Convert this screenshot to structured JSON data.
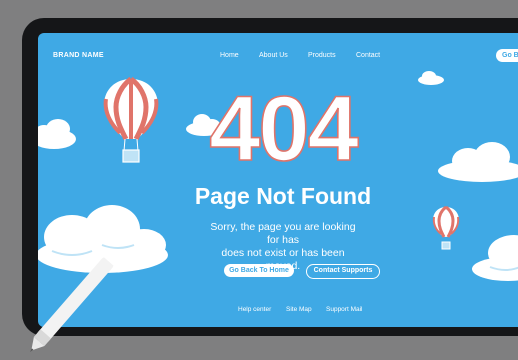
{
  "header": {
    "brand": "BRAND NAME",
    "nav": [
      "Home",
      "About Us",
      "Products",
      "Contact"
    ],
    "cta_label": "Go B"
  },
  "main": {
    "code": "404",
    "title": "Page Not Found",
    "message_line1": "Sorry, the page you are looking for has",
    "message_line2": "does not exist or has been moved.",
    "buttons": {
      "home": "Go Back To Home",
      "contact": "Contact Supports"
    }
  },
  "footer": {
    "links": [
      "Help center",
      "Site Map",
      "Support Mail"
    ]
  },
  "colors": {
    "sky": "#3fa9e5",
    "balloon": "#e0746a",
    "white": "#ffffff",
    "frame": "#151618"
  }
}
